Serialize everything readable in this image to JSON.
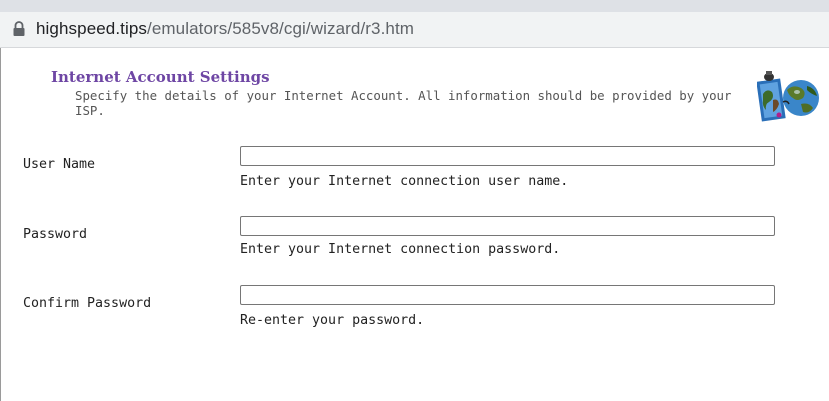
{
  "browser": {
    "url_host": "highspeed.tips",
    "url_path": "/emulators/585v8/cgi/wizard/r3.htm",
    "lock_icon": "lock-icon"
  },
  "header": {
    "title": "Internet Account Settings",
    "description": "Specify the details of your Internet Account. All information should be provided by your ISP.",
    "icon": "globe-icon"
  },
  "fields": [
    {
      "label": "User Name",
      "value": "",
      "hint": "Enter your Internet connection user name."
    },
    {
      "label": "Password",
      "value": "",
      "hint": "Enter your Internet connection password."
    },
    {
      "label": "Confirm Password",
      "value": "",
      "hint": "Re-enter your password."
    }
  ],
  "colors": {
    "title": "#6e46a4",
    "address_bar": "#f1f3f4"
  }
}
